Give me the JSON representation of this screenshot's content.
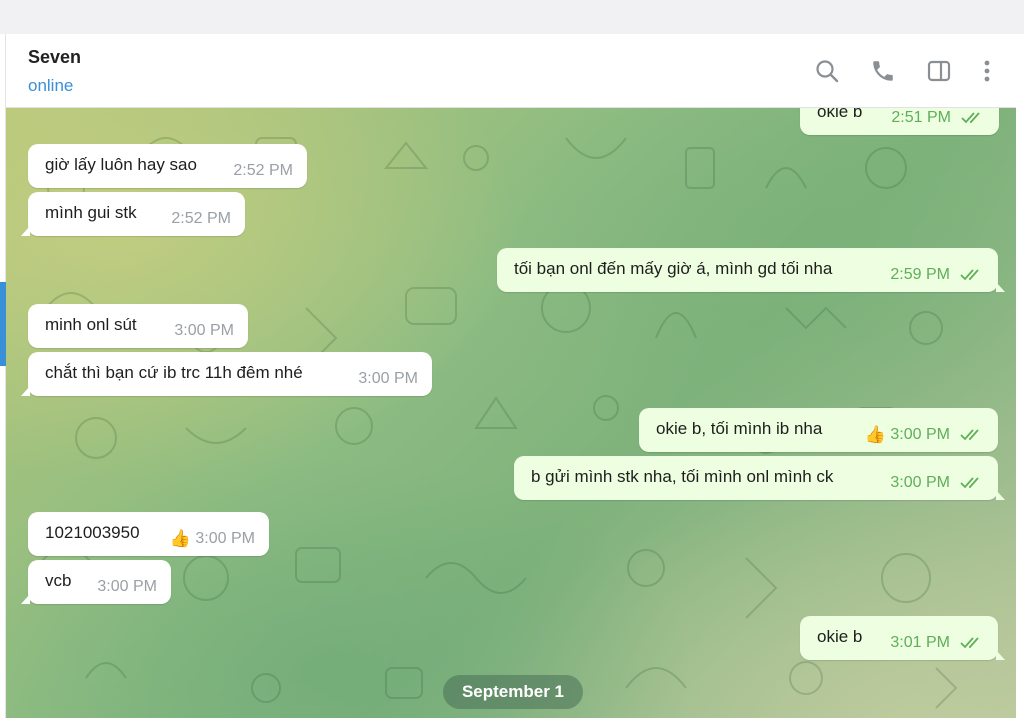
{
  "header": {
    "title": "Seven",
    "status": "online",
    "icons": [
      "search-icon",
      "phone-icon",
      "sidebar-toggle-icon",
      "more-vertical-icon"
    ]
  },
  "colors": {
    "accent": "#3a8fd9",
    "incoming_bubble": "#ffffff",
    "outgoing_bubble": "#eefee0",
    "outgoing_time": "#5fae5a"
  },
  "messages": [
    {
      "direction": "out",
      "text": "okie b",
      "time": "2:51 PM",
      "read": true
    },
    {
      "direction": "in",
      "text": "giờ lấy luôn hay sao",
      "time": "2:52 PM"
    },
    {
      "direction": "in",
      "text": "mình gui stk",
      "time": "2:52 PM"
    },
    {
      "direction": "out",
      "text": "tối bạn onl đến mấy giờ á, mình gd tối nha",
      "time": "2:59 PM",
      "read": true
    },
    {
      "direction": "in",
      "text": "minh onl sút",
      "time": "3:00 PM"
    },
    {
      "direction": "in",
      "text": "chắt thì bạn cứ ib trc 11h đêm nhé",
      "time": "3:00 PM"
    },
    {
      "direction": "out",
      "text": "okie b, tối mình ib nha",
      "time": "3:00 PM",
      "reaction": "👍",
      "read": true
    },
    {
      "direction": "out",
      "text": "b gửi mình stk nha, tối mình onl mình ck",
      "time": "3:00 PM",
      "read": true
    },
    {
      "direction": "in",
      "text": "1021003950",
      "time": "3:00 PM",
      "reaction": "👍"
    },
    {
      "direction": "in",
      "text": "vcb",
      "time": "3:00 PM"
    },
    {
      "direction": "out",
      "text": "okie b",
      "time": "3:01 PM",
      "read": true
    }
  ],
  "date_separator": "September 1"
}
